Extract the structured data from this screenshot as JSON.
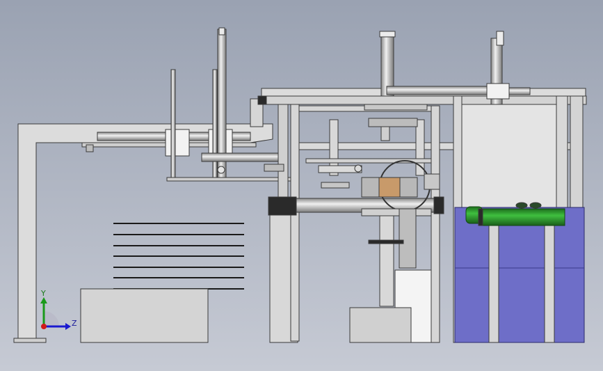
{
  "viewport": {
    "background_top": "#9aa2b2",
    "background_bottom": "#c4c8d2"
  },
  "triad": {
    "y_label": "Y",
    "z_label": "Z",
    "y_color": "#1a9a1a",
    "z_color": "#1a1ad0",
    "origin_color": "#d01a1a"
  },
  "colors": {
    "frame": "#d8d8d8",
    "frame_stroke": "#3a3a3a",
    "blue_tank": "#6e6ec8",
    "green_cylinder": "#2f9a2f",
    "dark_part": "#2a2a2a",
    "white_part": "#f4f4f4"
  }
}
